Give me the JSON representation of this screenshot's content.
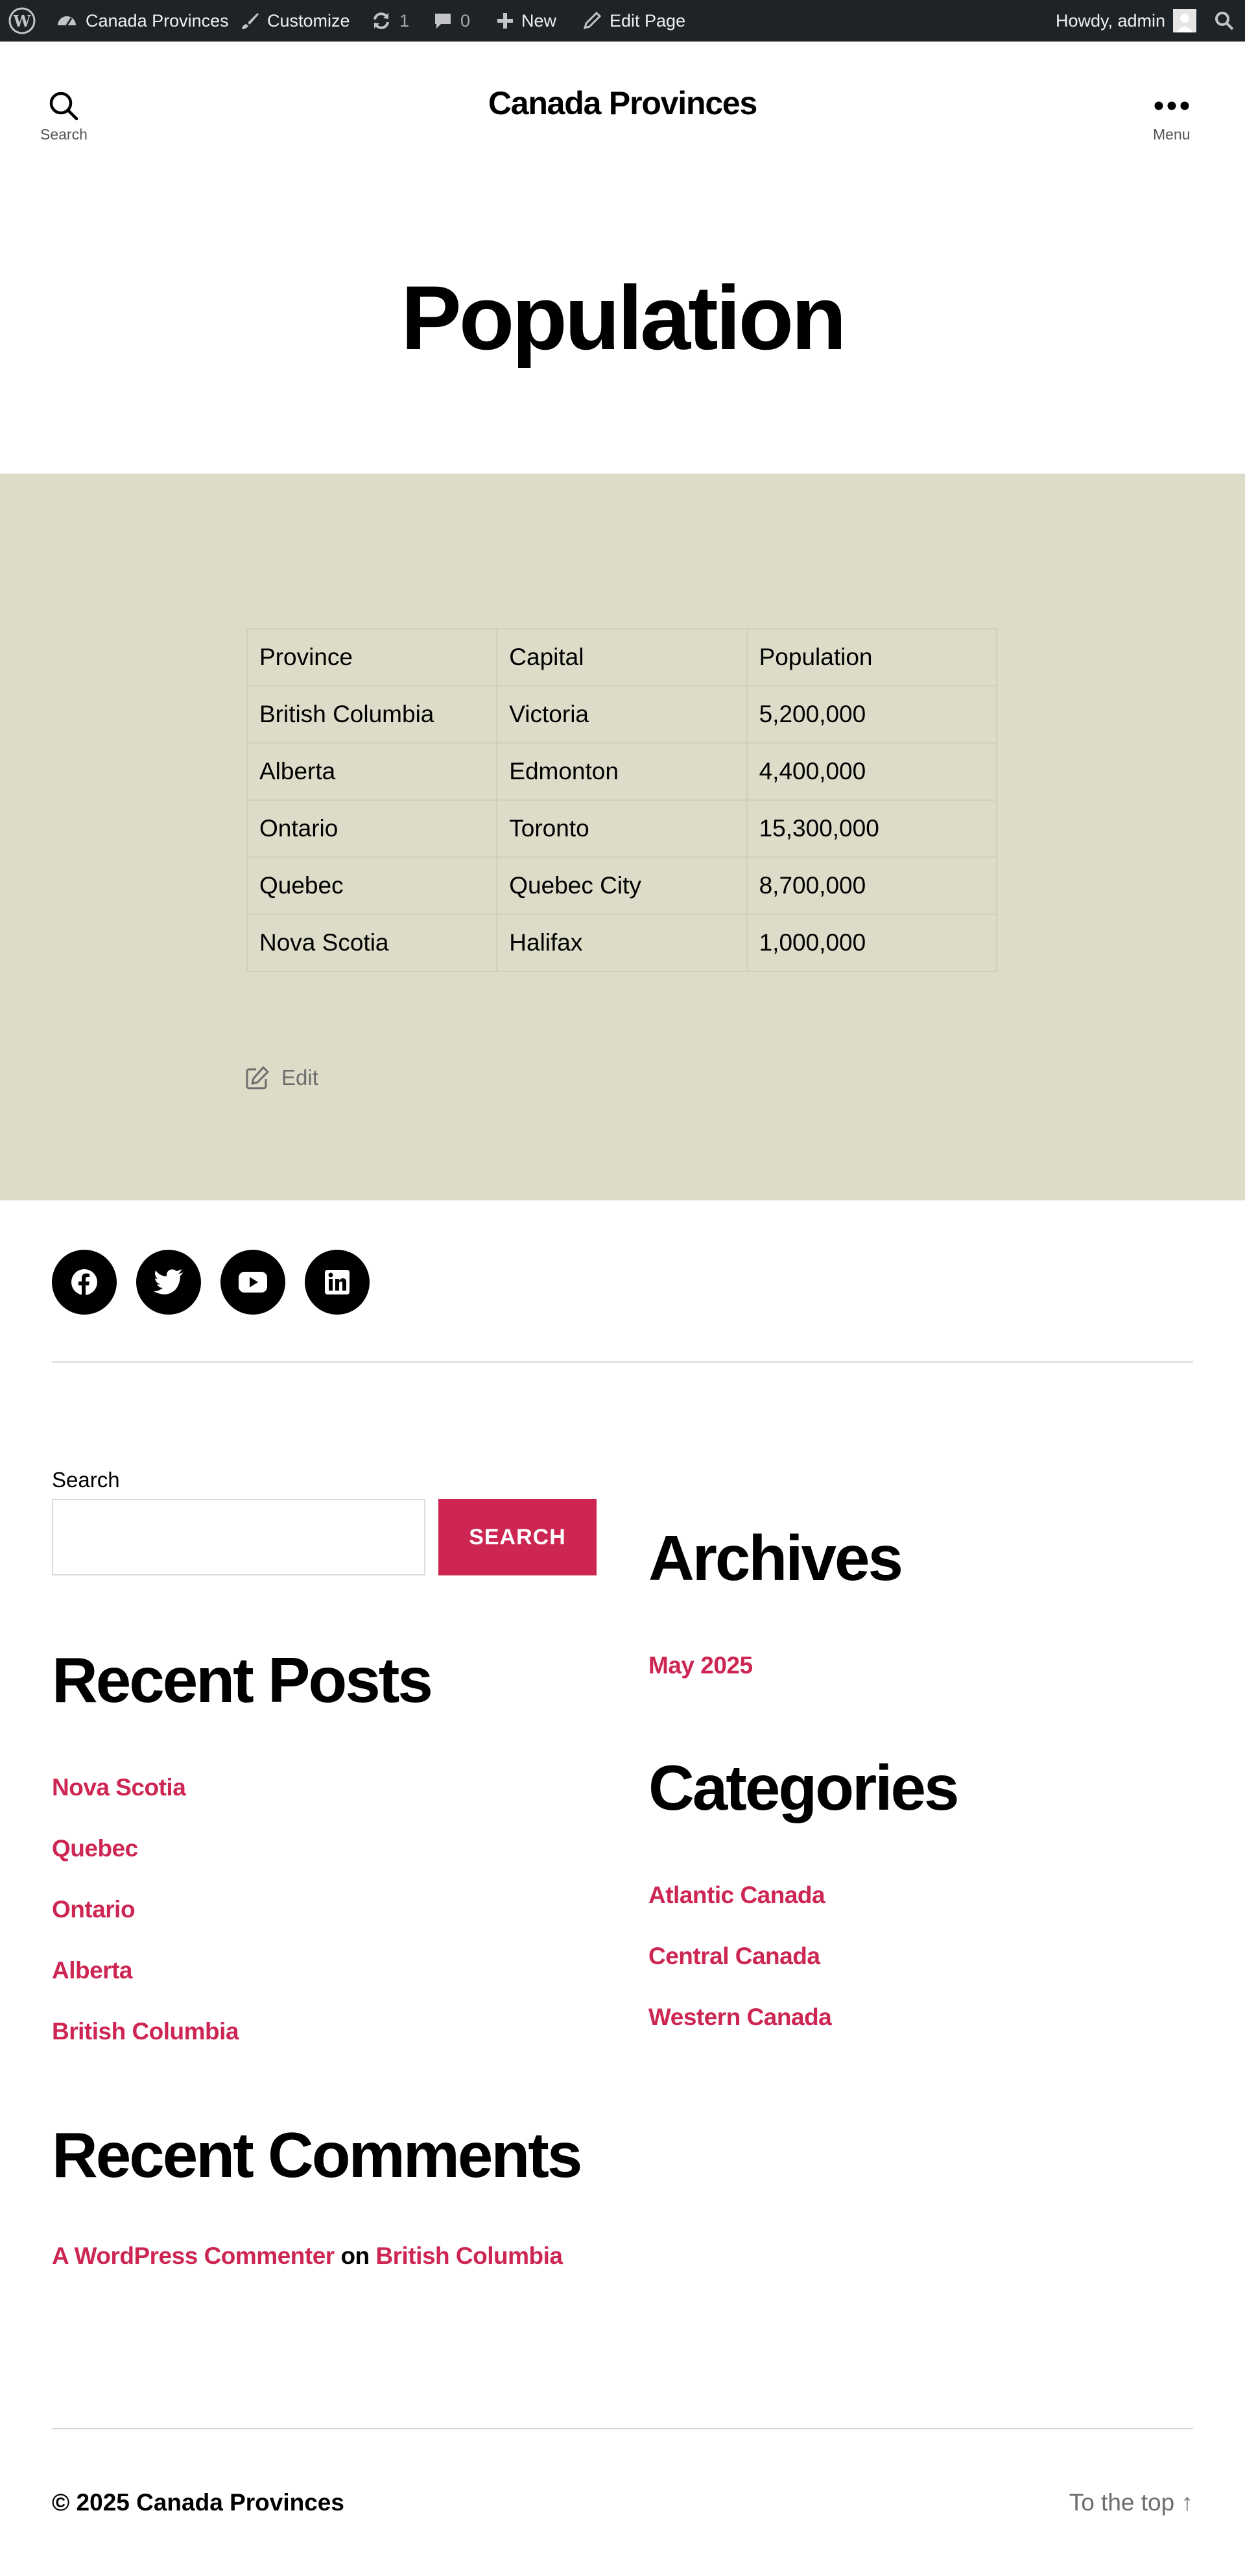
{
  "admin_bar": {
    "site_name": "Canada Provinces",
    "customize": "Customize",
    "updates_count": "1",
    "comments_count": "0",
    "new": "New",
    "edit_page": "Edit Page",
    "howdy": "Howdy, admin"
  },
  "header": {
    "search_label": "Search",
    "site_title": "Canada Provinces",
    "menu_label": "Menu"
  },
  "page_title": "Population",
  "table": {
    "headers": [
      "Province",
      "Capital",
      "Population"
    ],
    "rows": [
      [
        "British Columbia",
        "Victoria",
        "5,200,000"
      ],
      [
        "Alberta",
        "Edmonton",
        "4,400,000"
      ],
      [
        "Ontario",
        "Toronto",
        "15,300,000"
      ],
      [
        "Quebec",
        "Quebec City",
        "8,700,000"
      ],
      [
        "Nova Scotia",
        "Halifax",
        "1,000,000"
      ]
    ]
  },
  "edit_label": "Edit",
  "social": [
    "facebook-icon",
    "twitter-icon",
    "youtube-icon",
    "linkedin-icon"
  ],
  "widgets": {
    "search_label": "Search",
    "search_button": "SEARCH",
    "recent_posts_title": "Recent Posts",
    "recent_posts": [
      "Nova Scotia",
      "Quebec",
      "Ontario",
      "Alberta",
      "British Columbia"
    ],
    "archives_title": "Archives",
    "archives": [
      "May 2025"
    ],
    "categories_title": "Categories",
    "categories": [
      "Atlantic Canada",
      "Central Canada",
      "Western Canada"
    ],
    "recent_comments_title": "Recent Comments",
    "comment_author": "A WordPress Commenter",
    "comment_on": "on",
    "comment_post": "British Columbia"
  },
  "footer": {
    "copyright": "© 2025 Canada Provinces",
    "to_top": "To the top ↑"
  },
  "colors": {
    "accent": "#cd2653",
    "band": "#dcdcc9",
    "admin_bar": "#1d2327"
  }
}
